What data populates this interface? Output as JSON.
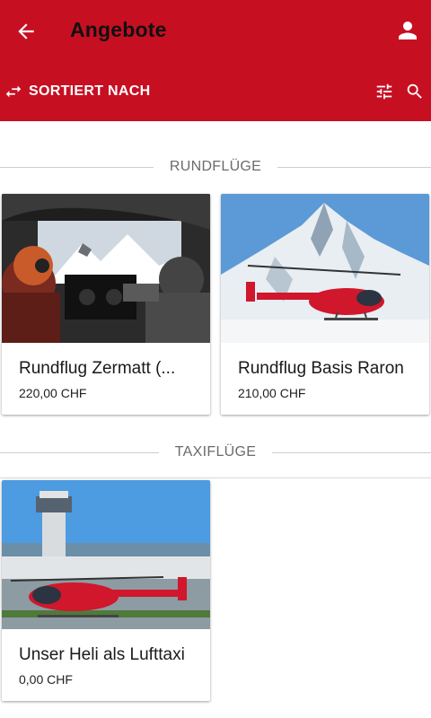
{
  "appbar": {
    "title": "Angebote",
    "back_icon": "arrow-back-icon",
    "account_icon": "account-icon",
    "sort_label": "SORTIERT NACH",
    "sort_icon": "swap-arrows-icon",
    "filter_icon": "tune-icon",
    "search_icon": "search-icon",
    "color": "#c70f22"
  },
  "sections": [
    {
      "title": "RUNDFLÜGE",
      "items": [
        {
          "name": "Rundflug Zermatt (...",
          "price": "220,00 CHF",
          "image": "helicopter-cockpit-photo"
        },
        {
          "name": "Rundflug Basis Raron",
          "price": "210,00 CHF",
          "image": "helicopter-mountain-photo"
        }
      ]
    },
    {
      "title": "TAXIFLÜGE",
      "items": [
        {
          "name": "Unser Heli als Lufttaxi",
          "price": "0,00 CHF",
          "image": "helicopter-airport-photo"
        }
      ]
    }
  ]
}
